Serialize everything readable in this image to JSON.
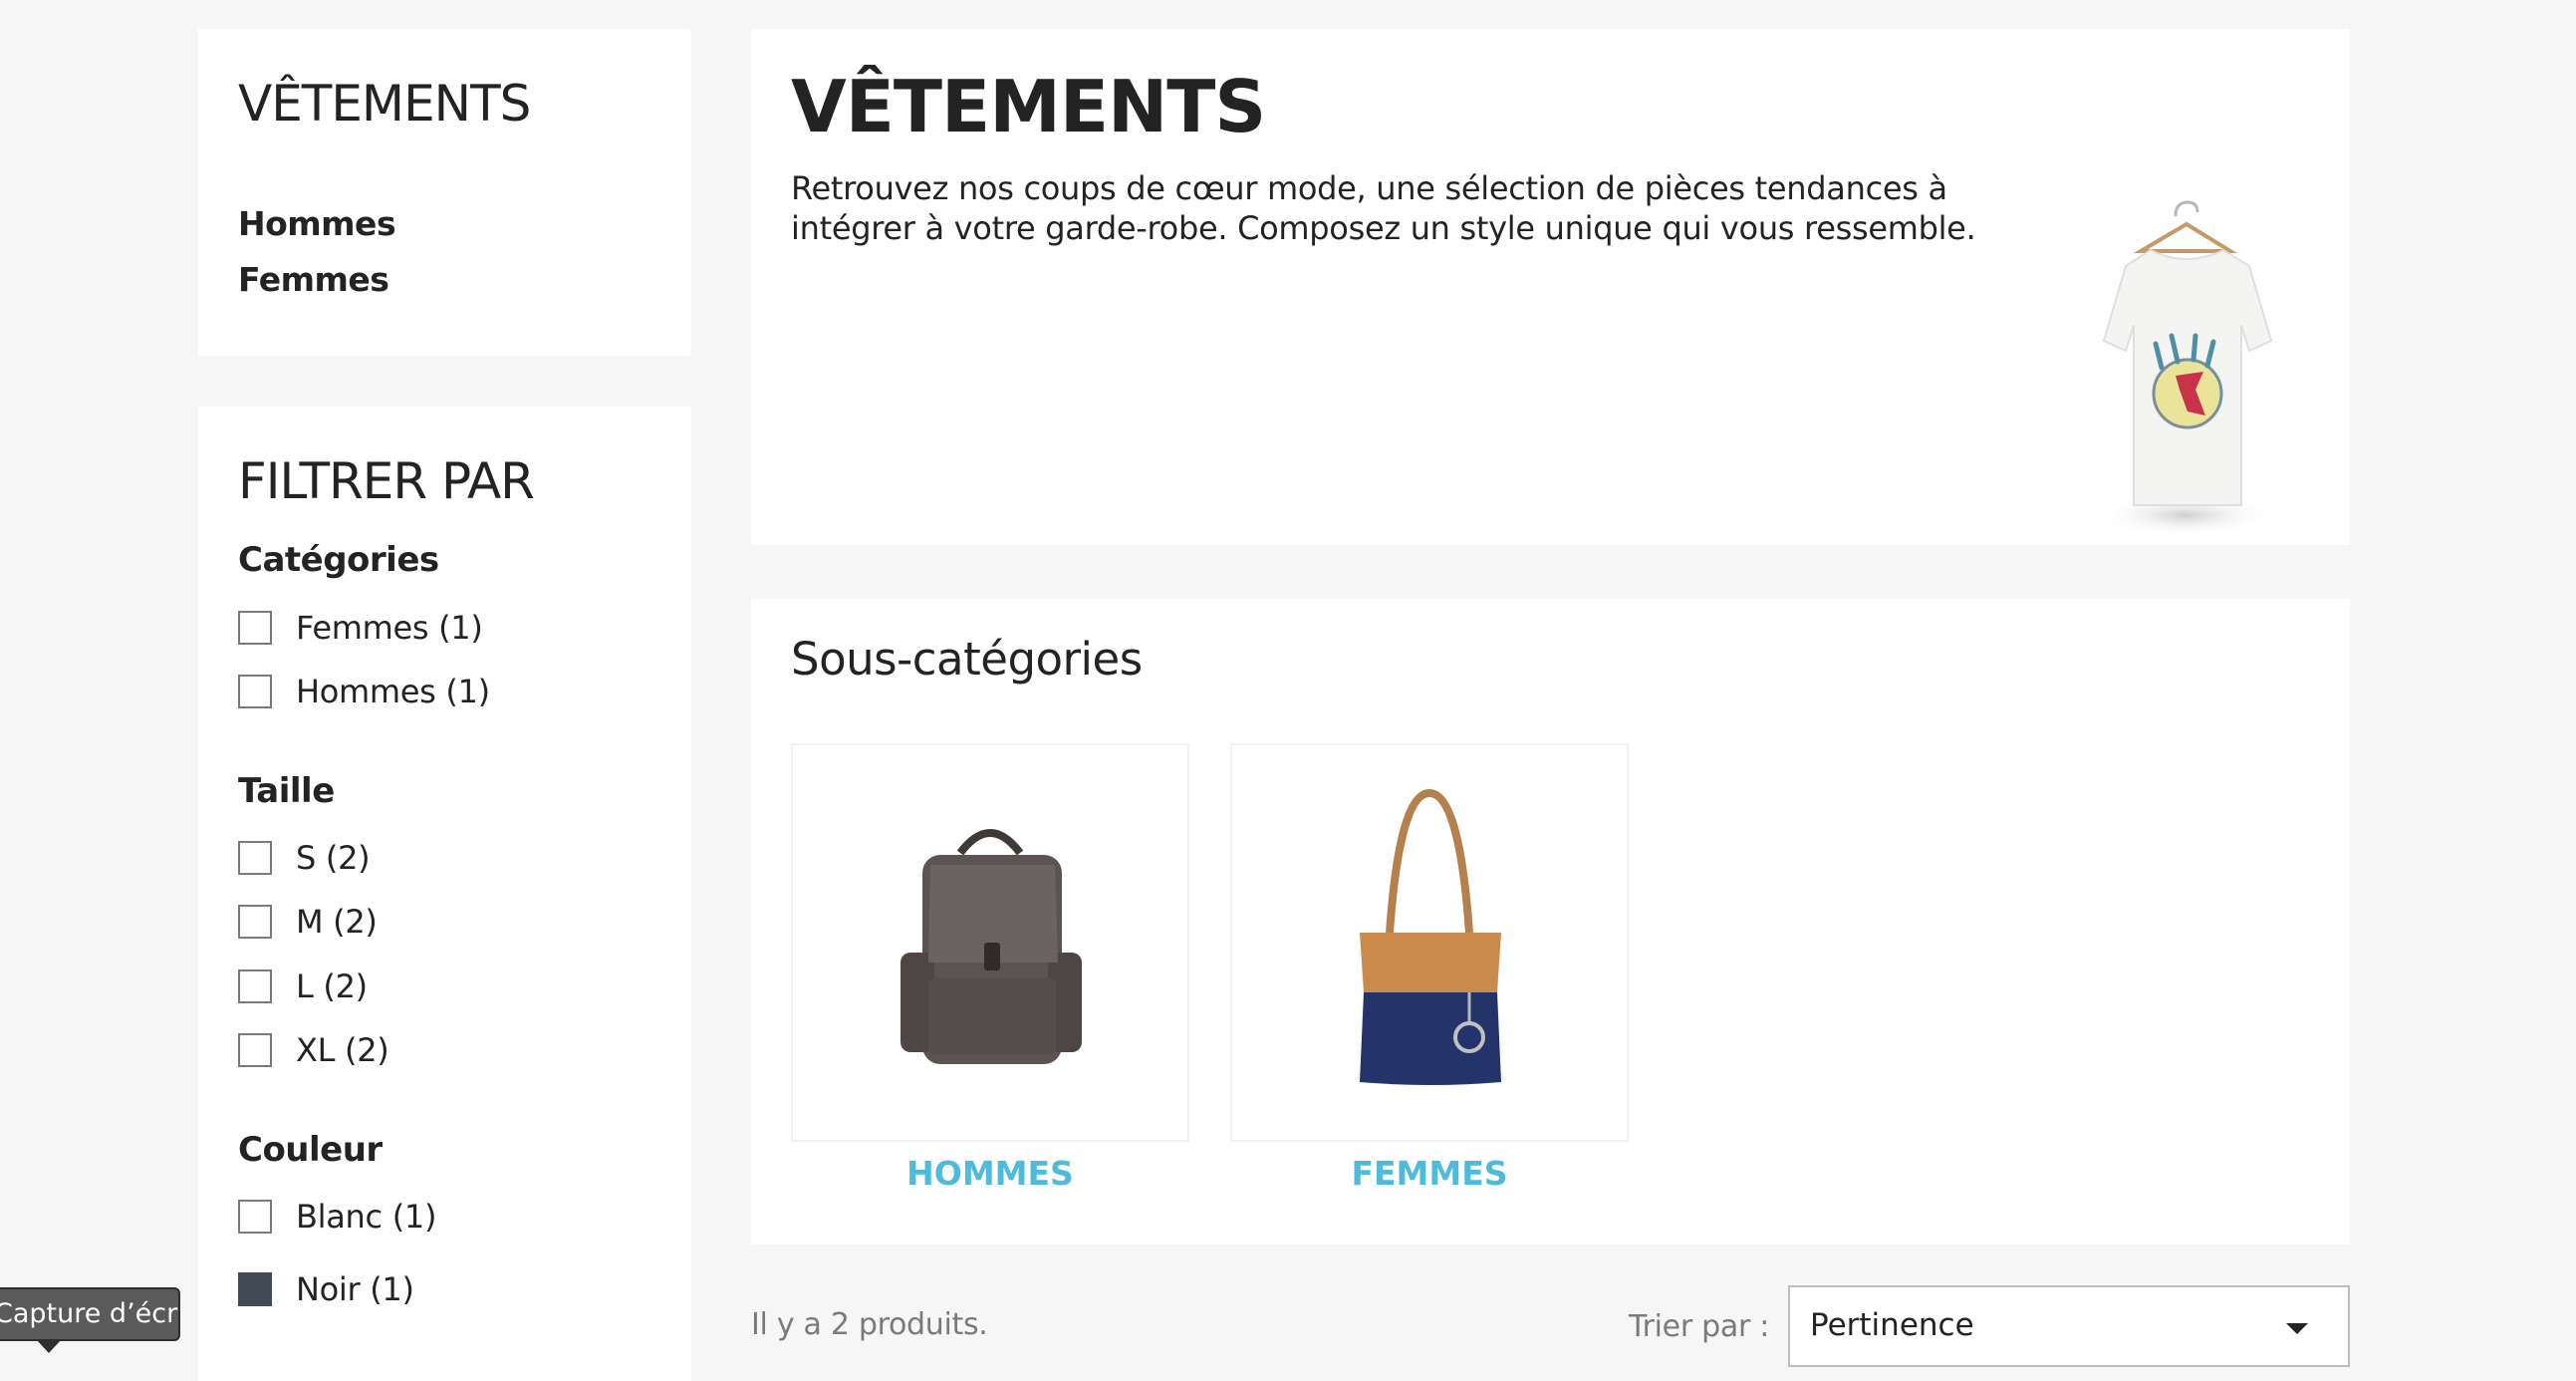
{
  "category_block": {
    "title": "VÊTEMENTS",
    "links": [
      "Hommes",
      "Femmes"
    ]
  },
  "filters": {
    "title": "FILTRER PAR",
    "facets": [
      {
        "title": "Catégories",
        "options": [
          "Femmes (1)",
          "Hommes (1)"
        ]
      },
      {
        "title": "Taille",
        "options": [
          "S (2)",
          "M (2)",
          "L (2)",
          "XL (2)"
        ]
      },
      {
        "title": "Couleur",
        "options": [
          "Blanc (1)",
          "Noir (1)"
        ]
      }
    ]
  },
  "tooltip": {
    "text": "Capture d’écran"
  },
  "category_header": {
    "title": "VÊTEMENTS",
    "description": "Retrouvez nos coups de cœur mode, une sélection de pièces tendances à intégrer à votre garde-robe. Composez un style unique qui vous ressemble.",
    "image": "tshirt-hanger-image"
  },
  "subcategories": {
    "title": "Sous-catégories",
    "items": [
      {
        "name": "HOMMES",
        "image": "backpack-image"
      },
      {
        "name": "FEMMES",
        "image": "handbag-image"
      }
    ]
  },
  "products": {
    "count_text": "Il y a 2 produits.",
    "sort_label": "Trier par :",
    "sort_value": "Pertinence"
  },
  "colors": {
    "accent_link": "#4ebbdc",
    "background": "#f6f6f6",
    "swatch_noir": "#414a55"
  }
}
